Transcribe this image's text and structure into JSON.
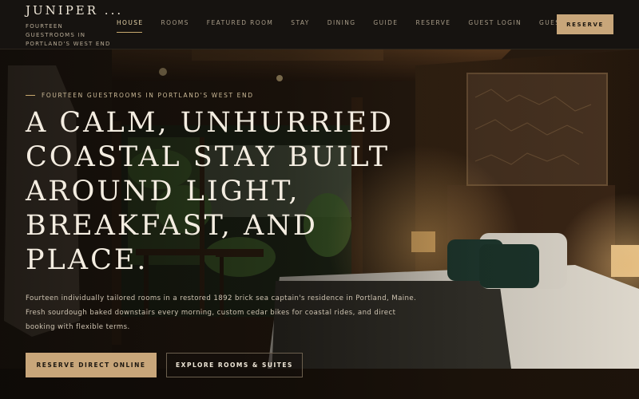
{
  "brand": {
    "name": "JUNIPER ...",
    "tagline": "FOURTEEN GUESTROOMS IN PORTLAND'S WEST END"
  },
  "nav": {
    "items": [
      {
        "label": "HOUSE"
      },
      {
        "label": "ROOMS"
      },
      {
        "label": "FEATURED ROOM"
      },
      {
        "label": "STAY"
      },
      {
        "label": "DINING"
      },
      {
        "label": "GUIDE"
      },
      {
        "label": "RESERVE"
      },
      {
        "label": "GUEST LOGIN"
      },
      {
        "label": "GUEST PORTAL"
      }
    ],
    "cta_label": "RESERVE"
  },
  "hero": {
    "eyebrow": "FOURTEEN GUESTROOMS IN PORTLAND'S WEST END",
    "headline": "A CALM, UNHURRIED COASTAL STAY BUILT AROUND LIGHT, BREAKFAST, AND PLACE.",
    "lede": "Fourteen individually tailored rooms in a restored 1892 brick sea captain's residence in Portland, Maine. Fresh sourdough baked downstairs every morning, custom cedar bikes for coastal rides, and direct booking with flexible terms.",
    "primary_cta": "RESERVE DIRECT ONLINE",
    "secondary_cta": "EXPLORE ROOMS & SUITES"
  },
  "colors": {
    "accent": "#c8a67a",
    "header_bg": "#161310",
    "text_light": "#f4ede1"
  }
}
